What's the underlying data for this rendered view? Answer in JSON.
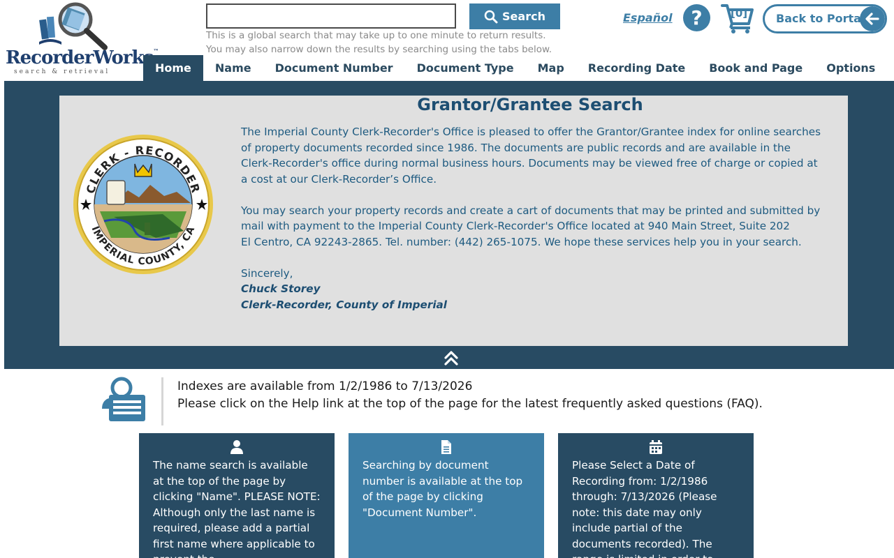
{
  "header": {
    "logo_word": "RecorderWorks",
    "logo_trademark": "™",
    "logo_tagline": "search & retrieval",
    "search_placeholder": "",
    "search_button": "Search",
    "search_help_line1": "This is a global search that may take up to one minute to return results.",
    "search_help_line2": "You may also narrow down the results by searching using the tabs below.",
    "language_link": "Español",
    "help_label": "?",
    "cart_count": "[0]",
    "back_button": "Back to Portal"
  },
  "nav": {
    "tabs": [
      {
        "label": "Home",
        "active": true
      },
      {
        "label": "Name"
      },
      {
        "label": "Document Number"
      },
      {
        "label": "Document Type"
      },
      {
        "label": "Map"
      },
      {
        "label": "Recording Date"
      },
      {
        "label": "Book and Page"
      },
      {
        "label": "Options"
      }
    ]
  },
  "banner": {
    "title": "Grantor/Grantee Search",
    "seal_top_text": "CLERK - RECORDER",
    "seal_bottom_text": "IMPERIAL COUNTY, CA",
    "paragraph1": "The Imperial County Clerk-Recorder's Office is pleased to offer the Grantor/Grantee index for online searches of property documents recorded since 1986. The documents are public records and are available in the Clerk-Recorder's office during normal business hours. Documents may be viewed free of charge or copied at a cost at our Clerk-Recorder’s Office.",
    "paragraph2": "You may search your property records and create a cart of documents that may be printed and submitted by mail with payment to the Imperial County Clerk-Recorder's Office located at 940 Main Street, Suite 202",
    "paragraph3": "El Centro, CA 92243-2865. Tel. number: (442) 265-1075. We hope these services help you in your search.",
    "closing": "Sincerely,",
    "signature_name": "Chuck Storey",
    "signature_title": "Clerk-Recorder, County of Imperial"
  },
  "info": {
    "line1": "Indexes are available from 1/2/1986 to 7/13/2026",
    "line2": "Please click on the Help link at the top of the page for the latest frequently asked questions (FAQ)."
  },
  "cards": [
    {
      "icon": "user-icon",
      "text": "The name search is available at the top of the page by clicking \"Name\". PLEASE NOTE: Although only the last name is required, please add a partial first name where applicable to prevent the"
    },
    {
      "icon": "document-icon",
      "text": "Searching by document number is available at the top of the page by clicking \"Document Number\"."
    },
    {
      "icon": "calendar-icon",
      "text": "Please Select a Date of Recording from: 1/2/1986 through: 7/13/2026 (Please note: this date may only include partial of the documents recorded). The range is limited in order to"
    }
  ],
  "colors": {
    "navy": "#284b63",
    "accent": "#3d7ea6",
    "panel": "#e0e0e0",
    "title_text": "#1d4e72"
  }
}
